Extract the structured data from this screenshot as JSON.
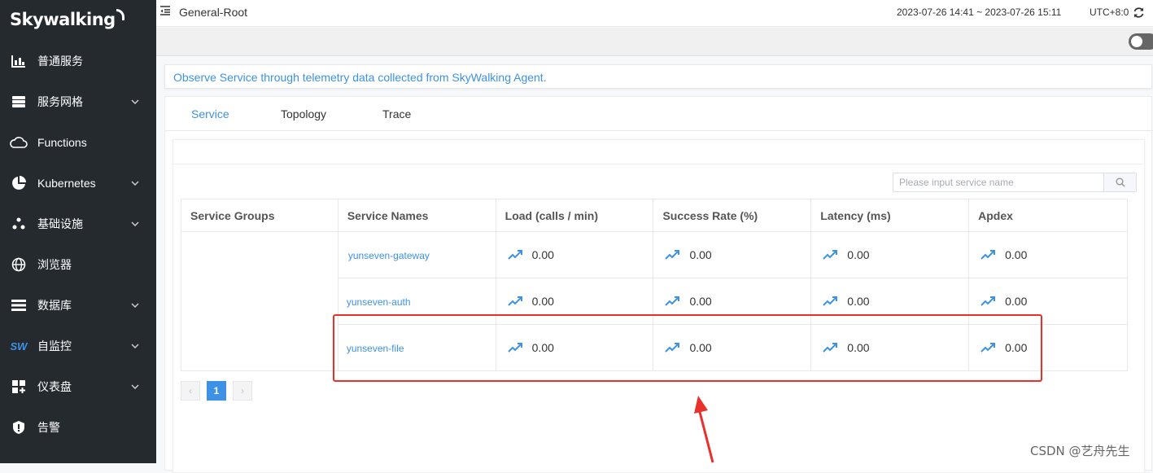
{
  "app": {
    "logo_text": "Skywalking"
  },
  "sidebar": {
    "items": [
      {
        "label": "普通服务",
        "icon": "bar-chart-icon",
        "has_submenu": false
      },
      {
        "label": "服务网格",
        "icon": "server-stack-icon",
        "has_submenu": true
      },
      {
        "label": "Functions",
        "icon": "cloud-icon",
        "has_submenu": false
      },
      {
        "label": "Kubernetes",
        "icon": "pie-chart-icon",
        "has_submenu": true
      },
      {
        "label": "基础设施",
        "icon": "nodes-icon",
        "has_submenu": true
      },
      {
        "label": "浏览器",
        "icon": "globe-icon",
        "has_submenu": false
      },
      {
        "label": "数据库",
        "icon": "database-list-icon",
        "has_submenu": true
      },
      {
        "label": "自监控",
        "icon": "sw-logo-icon",
        "has_submenu": true
      },
      {
        "label": "仪表盘",
        "icon": "dashboard-grid-icon",
        "has_submenu": true
      },
      {
        "label": "告警",
        "icon": "alert-shield-icon",
        "has_submenu": false
      }
    ],
    "sw_icon_text": "SW"
  },
  "header": {
    "title": "General-Root",
    "time_range": "2023-07-26 14:41 ~ 2023-07-26 15:11",
    "timezone": "UTC+8:0"
  },
  "notice": "Observe Service through telemetry data collected from SkyWalking Agent.",
  "tabs": [
    {
      "label": "Service",
      "active": true
    },
    {
      "label": "Topology",
      "active": false
    },
    {
      "label": "Trace",
      "active": false
    }
  ],
  "search": {
    "placeholder": "Please input service name",
    "value": ""
  },
  "table": {
    "columns": [
      "Service Groups",
      "Service Names",
      "Load (calls / min)",
      "Success Rate (%)",
      "Latency (ms)",
      "Apdex"
    ],
    "rows": [
      {
        "group": "",
        "name": "yunseven-gateway",
        "load": "0.00",
        "success": "0.00",
        "latency": "0.00",
        "apdex": "0.00"
      },
      {
        "group": "",
        "name": "yunseven-auth",
        "load": "0.00",
        "success": "0.00",
        "latency": "0.00",
        "apdex": "0.00"
      },
      {
        "group": "",
        "name": "yunseven-file",
        "load": "0.00",
        "success": "0.00",
        "latency": "0.00",
        "apdex": "0.00"
      }
    ]
  },
  "pagination": {
    "current_page": "1",
    "prev": "‹",
    "next": "›"
  },
  "colors": {
    "sidebar_bg": "#252a2f",
    "accent": "#3d92e6",
    "highlight": "#e8312a"
  },
  "watermark": "CSDN @艺舟先生"
}
